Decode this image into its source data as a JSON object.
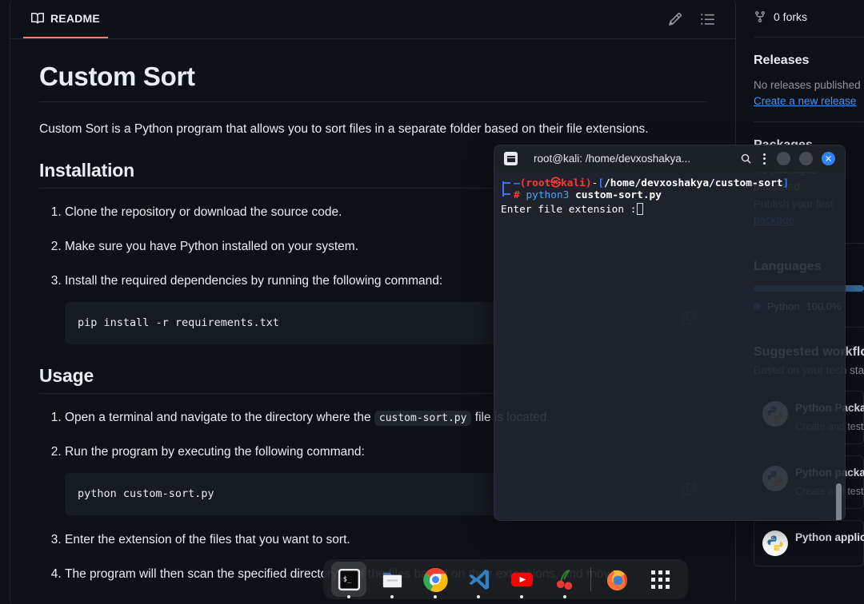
{
  "readme": {
    "tab_label": "README",
    "tab_icon": "book-icon",
    "edit_icon": "pencil-icon",
    "outline_icon": "list-outline-icon",
    "title": "Custom Sort",
    "intro": "Custom Sort is a Python program that allows you to sort files in a separate folder based on their file extensions.",
    "installation": {
      "heading": "Installation",
      "steps": [
        "Clone the repository or download the source code.",
        "Make sure you have Python installed on your system.",
        "Install the required dependencies by running the following command:"
      ],
      "code": "pip install -r requirements.txt"
    },
    "usage": {
      "heading": "Usage",
      "step1_before": "Open a terminal and navigate to the directory where the ",
      "step1_code": "custom-sort.py",
      "step1_after": " file is located.",
      "step2": "Run the program by executing the following command:",
      "code": "python custom-sort.py",
      "step3": "Enter the extension of the files that you want to sort.",
      "step4": "The program will then scan the specified directory, sort the files based on their extensions, and move"
    },
    "copy_icon": "copy-icon"
  },
  "sidebar": {
    "forks_icon": "fork-icon",
    "forks_label": "0 forks",
    "releases_heading": "Releases",
    "releases_none": "No releases published",
    "releases_link": "Create a new release",
    "packages_heading": "Packages",
    "packages_none": "No packages published",
    "packages_link_pre": "Publish your first ",
    "packages_link": "package",
    "languages_heading": "Languages",
    "language_name": "Python",
    "language_pct": "100.0%",
    "language_color": "#3572A5",
    "workflows_heading": "Suggested workflows",
    "workflows_sub": "Based on your tech stack",
    "workflows": [
      {
        "title": "Python Package using Anaconda",
        "desc": "Create and test a Python package on multiple Python versions using Anaconda for package management.",
        "logo": "python-logo-icon"
      },
      {
        "title": "Python package",
        "desc": "Create and test a Python package on multiple Python versions.",
        "logo": "python-logo-icon"
      },
      {
        "title": "Python application",
        "desc": "",
        "logo": "python-logo-icon"
      }
    ]
  },
  "terminal": {
    "app_icon": "terminal-app-icon",
    "title": "root@kali: /home/devxoshakya...",
    "search_icon": "search-icon",
    "menu_icon": "kebab-menu-icon",
    "minimize_label": "minimize",
    "maximize_label": "maximize",
    "close_label": "close",
    "prompt": {
      "open_paren": "(",
      "user": "root",
      "at": "@",
      "host": "kali",
      "close_paren": ")",
      "dash": "-",
      "bracket_open": "[",
      "cwd": "/home/devxoshakya/custom-sort",
      "bracket_close": "]",
      "hash": "#",
      "cmd_name": "python3",
      "cmd_arg": "custom-sort.py"
    },
    "output_line": "Enter file extension :",
    "colors": {
      "user_host": "#ff3b30",
      "path": "#3a78f2",
      "command": "#4aa3ff",
      "close_button": "#2f81f7"
    }
  },
  "dock": {
    "items": [
      {
        "name": "terminal",
        "icon": "terminal-icon",
        "running": true,
        "active": true
      },
      {
        "name": "files",
        "icon": "files-icon",
        "running": true,
        "active": false
      },
      {
        "name": "google-chrome",
        "icon": "chrome-icon",
        "running": true,
        "active": false
      },
      {
        "name": "visual-studio-code",
        "icon": "vscode-icon",
        "running": true,
        "active": false
      },
      {
        "name": "youtube",
        "icon": "youtube-icon",
        "running": true,
        "active": false
      },
      {
        "name": "cherry",
        "icon": "cherry-icon",
        "running": true,
        "active": false
      },
      {
        "name": "firefox",
        "icon": "firefox-icon",
        "running": false,
        "active": false
      },
      {
        "name": "show-applications",
        "icon": "apps-grid-icon",
        "running": false,
        "active": false
      }
    ]
  }
}
